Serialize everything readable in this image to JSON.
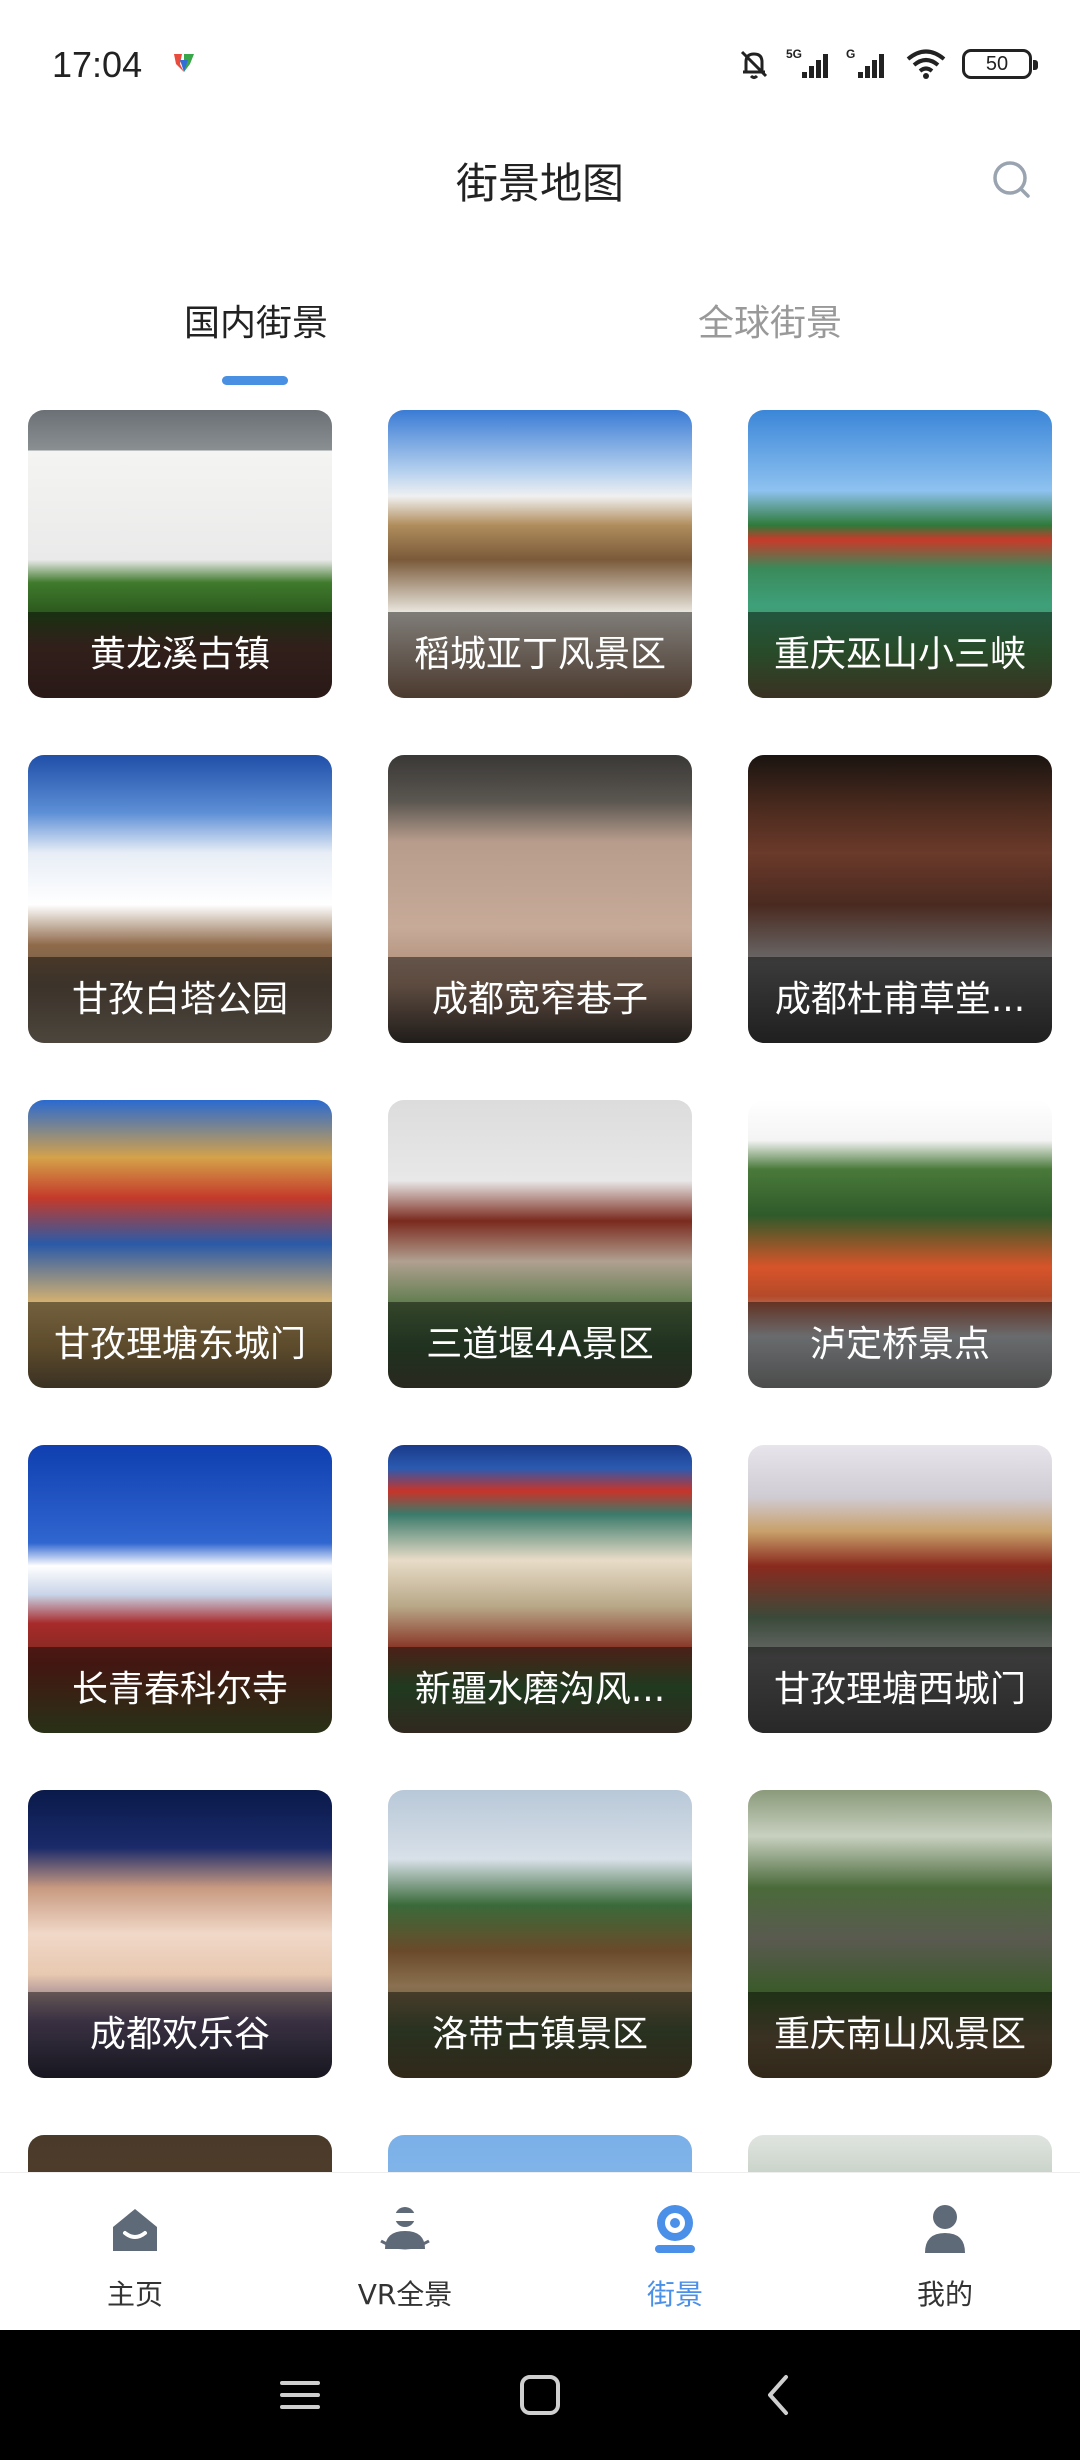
{
  "status_bar": {
    "time": "17:04",
    "battery": "50",
    "icons": [
      "notification-app-icon",
      "mute-bell-icon",
      "signal-5g-icon",
      "signal-icon",
      "wifi-icon",
      "battery-icon"
    ]
  },
  "header": {
    "title": "街景地图",
    "search_icon": "search-icon"
  },
  "tabs": [
    {
      "label": "国内街景",
      "active": true
    },
    {
      "label": "全球街景",
      "active": false
    }
  ],
  "colors": {
    "accent": "#4a90e2",
    "nav_active": "#4a8fe8",
    "text_primary": "#222222",
    "text_inactive": "#999999"
  },
  "scenic_spots": [
    {
      "label": "黄龙溪古镇"
    },
    {
      "label": "稻城亚丁风景区"
    },
    {
      "label": "重庆巫山小三峡"
    },
    {
      "label": "甘孜白塔公园"
    },
    {
      "label": "成都宽窄巷子"
    },
    {
      "label": "成都杜甫草堂..."
    },
    {
      "label": "甘孜理塘东城门"
    },
    {
      "label": "三道堰4A景区"
    },
    {
      "label": "泸定桥景点"
    },
    {
      "label": "长青春科尔寺"
    },
    {
      "label": "新疆水磨沟风..."
    },
    {
      "label": "甘孜理塘西城门"
    },
    {
      "label": "成都欢乐谷"
    },
    {
      "label": "洛带古镇景区"
    },
    {
      "label": "重庆南山风景区"
    }
  ],
  "bottom_nav": [
    {
      "label": "主页",
      "icon": "home-icon",
      "active": false
    },
    {
      "label": "VR全景",
      "icon": "vr-panorama-icon",
      "active": false
    },
    {
      "label": "街景",
      "icon": "street-view-icon",
      "active": true
    },
    {
      "label": "我的",
      "icon": "profile-icon",
      "active": false
    }
  ],
  "system_nav": [
    "menu-icon",
    "home-square-icon",
    "back-icon"
  ]
}
